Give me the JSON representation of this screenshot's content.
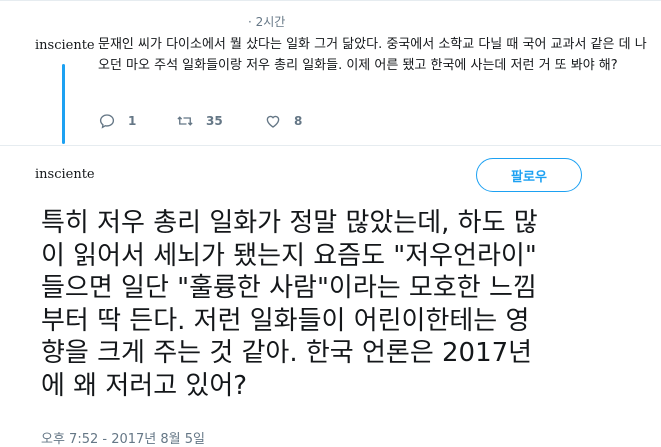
{
  "reply_tweet": {
    "author_handle": "insciente",
    "time_ago": "· 2시간",
    "text": "문재인 씨가 다이소에서 뭘 샀다는 일화 그거 닮았다. 중국에서 소학교 다닐 때 국어 교과서 같은 데 나오던 마오 주석 일화들이랑 저우 총리 일화들. 이제 어른 됐고 한국에 사는데 저런 거 또 봐야 해?",
    "actions": {
      "reply_count": "1",
      "retweet_count": "35",
      "like_count": "8"
    }
  },
  "main_tweet": {
    "author_handle": "insciente",
    "follow_label": "팔로우",
    "text": "특히 저우 총리 일화가 정말 많았는데, 하도 많\n이 읽어서 세뇌가 됐는지 요즘도 \"저우언라이\"\n들으면 일단 \"훌륭한 사람\"이라는 모호한 느낌\n부터 딱 든다. 저런 일화들이 어린이한테는 영\n향을 크게 주는 것 같아. 한국 언론은 2017년\n에 왜 저러고 있어?",
    "timestamp": "오후 7:52 - 2017년 8월 5일"
  },
  "colors": {
    "accent": "#1da1f2",
    "muted": "#657786",
    "text": "#14171a"
  },
  "icons": [
    "reply-icon",
    "retweet-icon",
    "like-icon"
  ]
}
